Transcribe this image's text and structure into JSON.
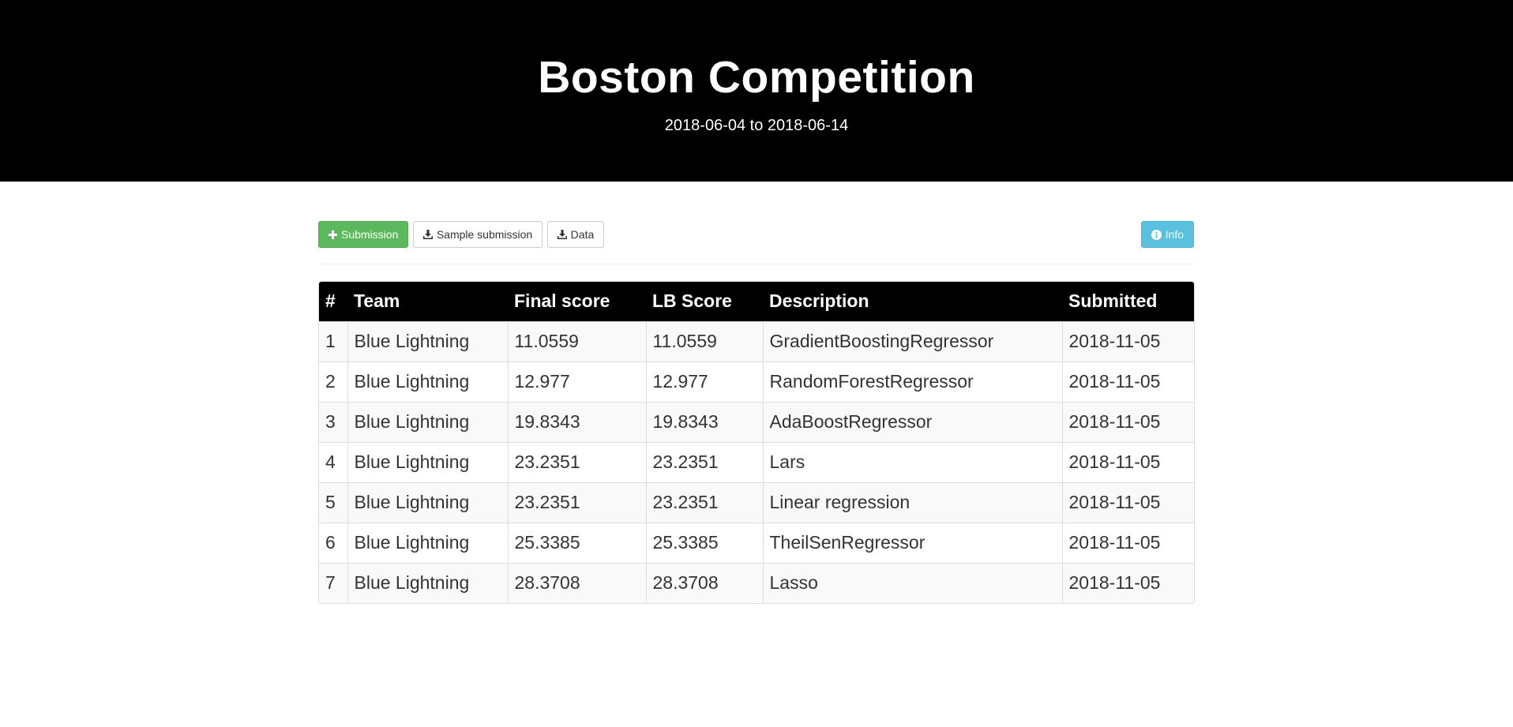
{
  "header": {
    "title": "Boston Competition",
    "dates": "2018-06-04 to 2018-06-14"
  },
  "toolbar": {
    "submission_label": "Submission",
    "sample_submission_label": "Sample submission",
    "data_label": "Data",
    "info_label": "Info"
  },
  "leaderboard": {
    "columns": [
      "#",
      "Team",
      "Final score",
      "LB Score",
      "Description",
      "Submitted"
    ],
    "rows": [
      [
        "1",
        "Blue Lightning",
        "11.0559",
        "11.0559",
        "GradientBoostingRegressor",
        "2018-11-05"
      ],
      [
        "2",
        "Blue Lightning",
        "12.977",
        "12.977",
        "RandomForestRegressor",
        "2018-11-05"
      ],
      [
        "3",
        "Blue Lightning",
        "19.8343",
        "19.8343",
        "AdaBoostRegressor",
        "2018-11-05"
      ],
      [
        "4",
        "Blue Lightning",
        "23.2351",
        "23.2351",
        "Lars",
        "2018-11-05"
      ],
      [
        "5",
        "Blue Lightning",
        "23.2351",
        "23.2351",
        "Linear regression",
        "2018-11-05"
      ],
      [
        "6",
        "Blue Lightning",
        "25.3385",
        "25.3385",
        "TheilSenRegressor",
        "2018-11-05"
      ],
      [
        "7",
        "Blue Lightning",
        "28.3708",
        "28.3708",
        "Lasso",
        "2018-11-05"
      ]
    ]
  },
  "colors": {
    "hero_bg": "#000000",
    "success": "#5cb85c",
    "info": "#5bc0de",
    "table_header_bg": "#000000",
    "row_stripe": "#f9f9f9"
  },
  "icons": {
    "submission": "plus-icon",
    "sample_submission": "download-icon",
    "data": "download-icon",
    "info": "info-circle-icon"
  }
}
